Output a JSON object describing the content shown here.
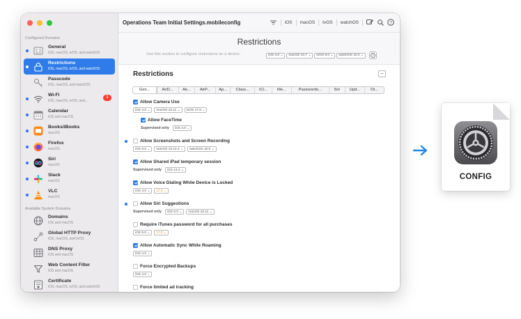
{
  "sidebar": {
    "configured_label": "Configured Domains",
    "available_label": "Available System Domains",
    "configured": [
      {
        "title": "General",
        "sub": "iOS, macOS, tvOS, and watchOS",
        "icon": "general-icon",
        "dot": true,
        "active": false,
        "badge": ""
      },
      {
        "title": "Restrictions",
        "sub": "iOS, macOS, tvOS, and watchOS",
        "icon": "restrictions-icon",
        "dot": true,
        "active": true,
        "badge": ""
      },
      {
        "title": "Passcode",
        "sub": "iOS, macOS, and watchOS",
        "icon": "key-icon",
        "dot": false,
        "active": false,
        "badge": ""
      },
      {
        "title": "Wi-Fi",
        "sub": "iOS, macOS, tvOS, and...",
        "icon": "wifi-icon",
        "dot": true,
        "active": false,
        "badge": "1"
      },
      {
        "title": "Calendar",
        "sub": "iOS and macOS",
        "icon": "calendar-icon",
        "dot": true,
        "active": false,
        "badge": ""
      },
      {
        "title": "Books/iBooks",
        "sub": "macOS",
        "icon": "books-icon",
        "dot": true,
        "active": false,
        "badge": ""
      },
      {
        "title": "Firefox",
        "sub": "macOS",
        "icon": "firefox-icon",
        "dot": true,
        "active": false,
        "badge": ""
      },
      {
        "title": "Siri",
        "sub": "macOS",
        "icon": "siri-icon",
        "dot": true,
        "active": false,
        "badge": ""
      },
      {
        "title": "Slack",
        "sub": "macOS",
        "icon": "slack-icon",
        "dot": true,
        "active": false,
        "badge": ""
      },
      {
        "title": "VLC",
        "sub": "macOS",
        "icon": "vlc-icon",
        "dot": true,
        "active": false,
        "badge": ""
      }
    ],
    "available": [
      {
        "title": "Domains",
        "sub": "iOS and macOS",
        "icon": "globe-icon"
      },
      {
        "title": "Global HTTP Proxy",
        "sub": "iOS, macOS, and tvOS",
        "icon": "proxy-icon"
      },
      {
        "title": "DNS Proxy",
        "sub": "iOS and macOS",
        "icon": "dns-icon"
      },
      {
        "title": "Web Content Filter",
        "sub": "iOS and macOS",
        "icon": "filter-icon"
      },
      {
        "title": "Certificate",
        "sub": "iOS, macOS, tvOS, and watchOS",
        "icon": "certificate-icon"
      }
    ]
  },
  "toolbar": {
    "title": "Operations Team Initial Settings.mobileconfig",
    "platforms": [
      "iOS",
      "macOS",
      "tvOS",
      "watchOS"
    ]
  },
  "header": {
    "title": "Restrictions",
    "description": "Use this section to configure restrictions on a device.",
    "tags": [
      "iOS 4.0",
      "macOS 10.7",
      "tvOS 9.0",
      "watchOS 10.0"
    ]
  },
  "section": {
    "title": "Restrictions",
    "collapse": "–",
    "tabs": [
      "Gen...",
      "AirD...",
      "Air...",
      "AirP...",
      "Ap...",
      "Class...",
      "iCl...",
      "Me...",
      "Passwords...",
      "Siri",
      "Upd...",
      "Ot..."
    ]
  },
  "items": [
    {
      "label": "Allow Camera Use",
      "checked": true,
      "dot": false,
      "indent": false,
      "supervised": false,
      "tags": [
        {
          "t": "iOS 4.0"
        },
        {
          "t": "macOS 10.11"
        },
        {
          "t": "tvOS 17.0"
        }
      ]
    },
    {
      "label": "Allow FaceTime",
      "checked": true,
      "dot": false,
      "indent": true,
      "supervised": true,
      "tags": [
        {
          "t": "iOS 4.0"
        }
      ]
    },
    {
      "label": "Allow Screenshots and Screen Recording",
      "checked": false,
      "dot": true,
      "indent": false,
      "supervised": false,
      "tags": [
        {
          "t": "iOS 9.0"
        },
        {
          "t": "macOS 10.14.4"
        },
        {
          "t": "watchOS 10.0"
        }
      ]
    },
    {
      "label": "Allow Shared iPad temporary session",
      "checked": true,
      "dot": false,
      "indent": false,
      "supervised": true,
      "tags": [
        {
          "t": "iOS 13.4"
        }
      ]
    },
    {
      "label": "Allow Voice Dialing While Device is Locked",
      "checked": true,
      "dot": false,
      "indent": false,
      "supervised": false,
      "tags": [
        {
          "t": "iOS 4.0"
        },
        {
          "t": "17.0",
          "warn": true
        }
      ]
    },
    {
      "label": "Allow Siri Suggestions",
      "checked": false,
      "dot": true,
      "indent": false,
      "supervised": true,
      "tags": [
        {
          "t": "iOS 9.0"
        },
        {
          "t": "macOS 10.11"
        }
      ]
    },
    {
      "label": "Require iTunes password for all purchases",
      "checked": false,
      "dot": false,
      "indent": false,
      "supervised": false,
      "tags": [
        {
          "t": "iOS 6.0"
        },
        {
          "t": "17.0",
          "warn": true
        }
      ]
    },
    {
      "label": "Allow Automatic Sync While Roaming",
      "checked": true,
      "dot": false,
      "indent": false,
      "supervised": false,
      "tags": [
        {
          "t": "iOS 4.0"
        }
      ]
    },
    {
      "label": "Force Encrypted Backups",
      "checked": false,
      "dot": false,
      "indent": false,
      "supervised": false,
      "tags": [
        {
          "t": "iOS 4.0"
        }
      ]
    },
    {
      "label": "Force limited ad tracking",
      "checked": false,
      "dot": false,
      "indent": false,
      "supervised": false,
      "tags": []
    }
  ],
  "supervised_label": "Supervised only",
  "config": {
    "label": "CONFIG"
  },
  "colors": {
    "accent": "#2f7bea",
    "arrow": "#1e88e5",
    "warn": "#e38b16"
  }
}
